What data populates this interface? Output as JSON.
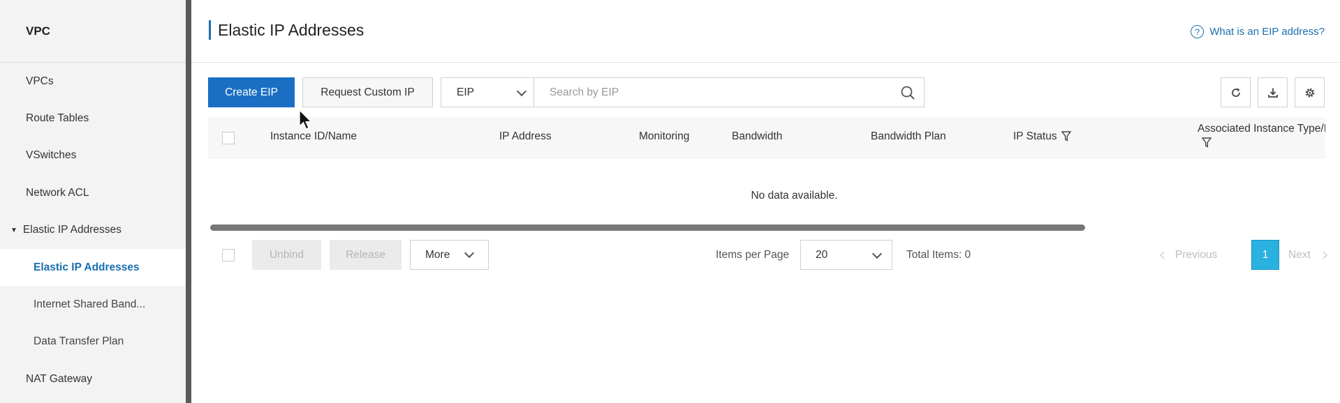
{
  "sidebar": {
    "title": "VPC",
    "items": [
      {
        "label": "VPCs"
      },
      {
        "label": "Route Tables"
      },
      {
        "label": "VSwitches"
      },
      {
        "label": "Network ACL"
      },
      {
        "label": "Elastic IP Addresses"
      },
      {
        "label": "Elastic IP Addresses"
      },
      {
        "label": "Internet Shared Band..."
      },
      {
        "label": "Data Transfer Plan"
      },
      {
        "label": "NAT Gateway"
      }
    ]
  },
  "header": {
    "title": "Elastic IP Addresses",
    "help_link": "What is an EIP address?",
    "help_icon": "?"
  },
  "toolbar": {
    "create_label": "Create EIP",
    "request_label": "Request Custom IP",
    "search_type": "EIP",
    "search_placeholder": "Search by EIP",
    "icons": [
      "refresh-icon",
      "download-icon",
      "settings-icon"
    ]
  },
  "table": {
    "columns": [
      "Instance ID/Name",
      "IP Address",
      "Monitoring",
      "Bandwidth",
      "Bandwidth Plan",
      "IP Status",
      "Associated Instance Type/ID"
    ],
    "empty_text": "No data available."
  },
  "footer": {
    "unbind_label": "Unbind",
    "release_label": "Release",
    "more_label": "More",
    "items_per_page_label": "Items per Page",
    "items_per_page_value": "20",
    "total_items": "Total Items: 0",
    "previous_label": "Previous",
    "next_label": "Next",
    "current_page": "1"
  },
  "colors": {
    "primary": "#1a6fc4",
    "link": "#1a6fb0",
    "page_active": "#29b1e0"
  }
}
